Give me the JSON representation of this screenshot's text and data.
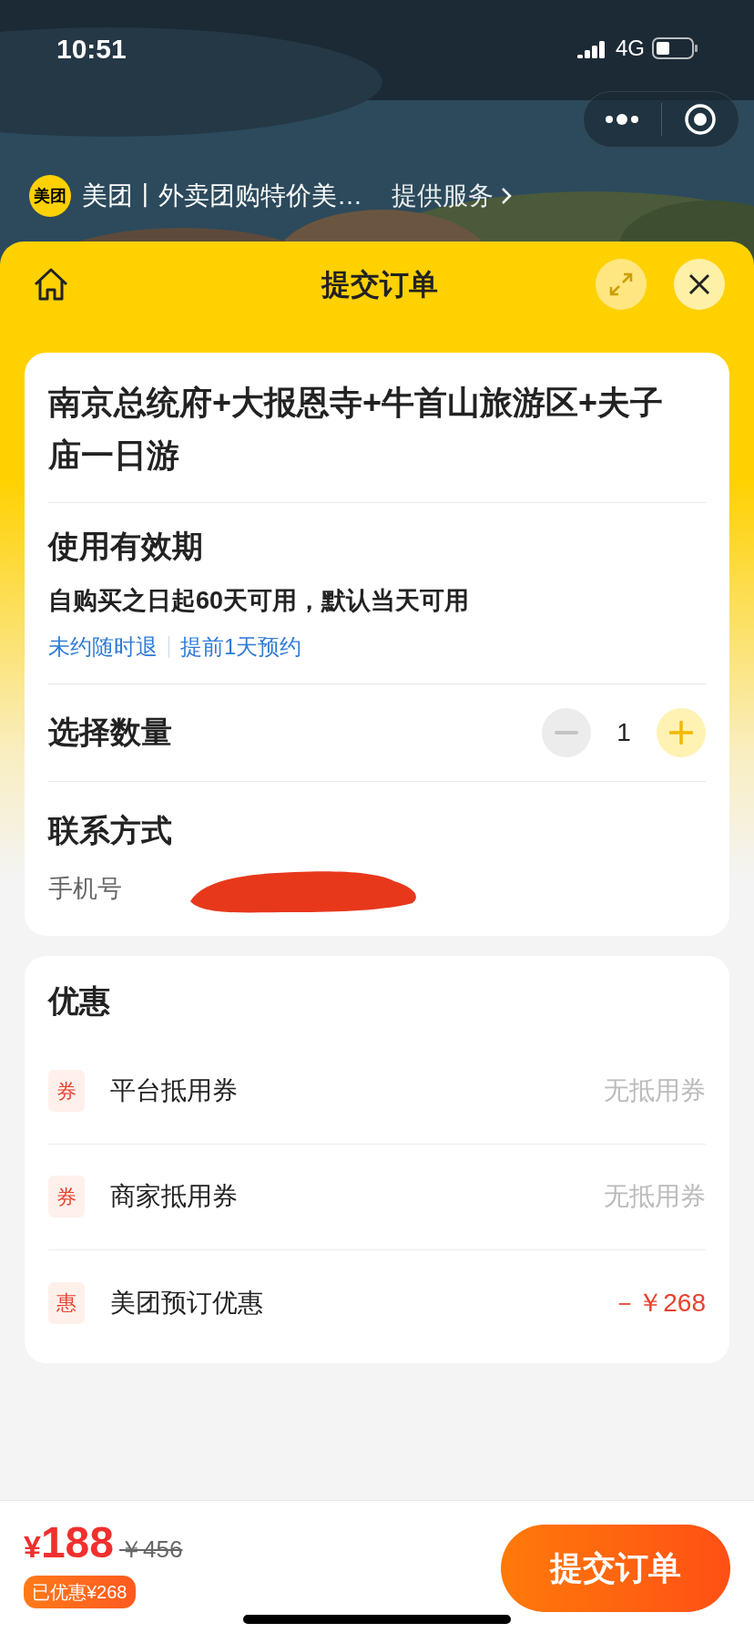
{
  "status_bar": {
    "time": "10:51",
    "network": "4G"
  },
  "merchant": {
    "badge": "美团",
    "name": "美团丨外卖团购特价美…",
    "link": "提供服务"
  },
  "header": {
    "title": "提交订单"
  },
  "product": {
    "title": "南京总统府+大报恩寺+牛首山旅游区+夫子庙一日游"
  },
  "validity": {
    "heading": "使用有效期",
    "text": "自购买之日起60天可用，默认当天可用",
    "tags": [
      "未约随时退",
      "提前1天预约"
    ]
  },
  "quantity": {
    "label": "选择数量",
    "value": "1",
    "minus_disabled": true
  },
  "contact": {
    "heading": "联系方式",
    "phone_label": "手机号"
  },
  "discounts": {
    "heading": "优惠",
    "items": [
      {
        "badge": "券",
        "label": "平台抵用券",
        "value": "无抵用券",
        "kind": "none"
      },
      {
        "badge": "券",
        "label": "商家抵用券",
        "value": "无抵用券",
        "kind": "none"
      },
      {
        "badge": "惠",
        "label": "美团预订优惠",
        "value": "－￥268",
        "kind": "amount"
      }
    ]
  },
  "footer": {
    "currency": "¥",
    "price": "188",
    "original_price": "￥456",
    "saved": "已优惠¥268",
    "submit": "提交订单"
  }
}
